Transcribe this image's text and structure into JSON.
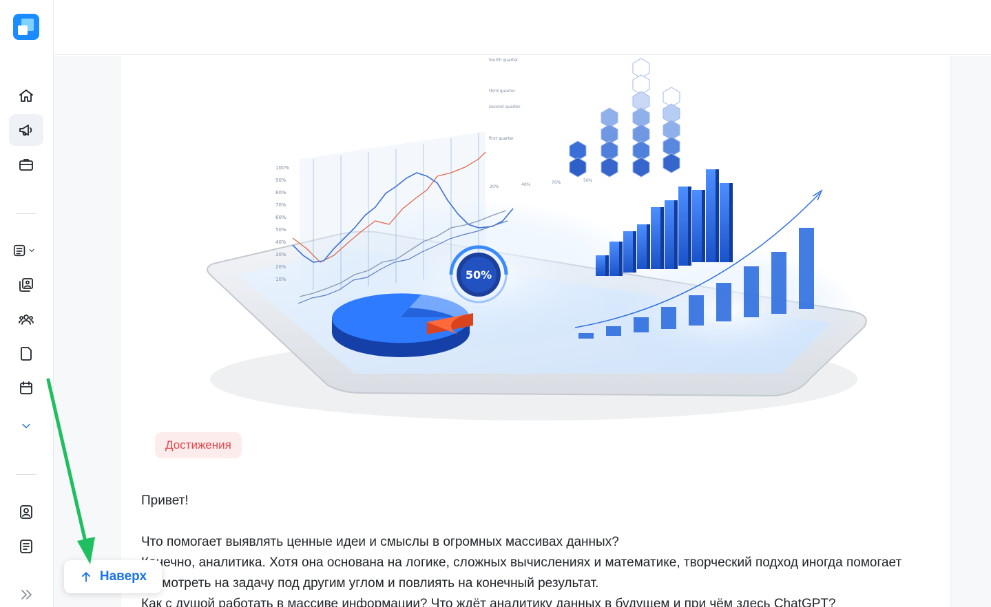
{
  "nav": {
    "items": [
      {
        "icon": "home-icon"
      },
      {
        "icon": "megaphone-icon",
        "active": true
      },
      {
        "icon": "briefcase-icon"
      },
      {
        "icon": "document-list-icon"
      },
      {
        "icon": "gallery-icon"
      },
      {
        "icon": "people-icon"
      },
      {
        "icon": "file-icon"
      },
      {
        "icon": "calendar-icon"
      },
      {
        "icon": "chevron-down-icon"
      },
      {
        "icon": "contact-card-icon"
      },
      {
        "icon": "notes-icon"
      }
    ]
  },
  "hero": {
    "badge_text": "50%",
    "y_ticks": [
      "100%",
      "90%",
      "80%",
      "70%",
      "60%",
      "50%",
      "40%",
      "30%",
      "20%",
      "10%"
    ],
    "hex_labels": [
      "fourth quarter",
      "third quarter",
      "second quarter",
      "first quarter"
    ],
    "hex_percents": [
      "20%",
      "40%",
      "70%",
      "50%"
    ]
  },
  "article": {
    "tag": "Достижения",
    "greeting": "Привет!",
    "paragraph1": "Что помогает выявлять ценные идеи и смыслы в огромных массивах данных?",
    "paragraph2": "Конечно, аналитика. Хотя она основана на логике, сложных вычислениях и математике, творческий подход иногда помогает посмотреть на задачу под другим углом и повлиять на конечный результат.",
    "paragraph3": "Как с душой работать в массиве информации? Что ждёт аналитику данных в будущем и при чём здесь ChatGPT?"
  },
  "scroll_top_button": {
    "label": "Наверх"
  },
  "colors": {
    "accent": "#1a73e8",
    "tag_bg": "#fdecec",
    "tag_text": "#e5484d",
    "annotation_arrow": "#1fbf5f"
  }
}
